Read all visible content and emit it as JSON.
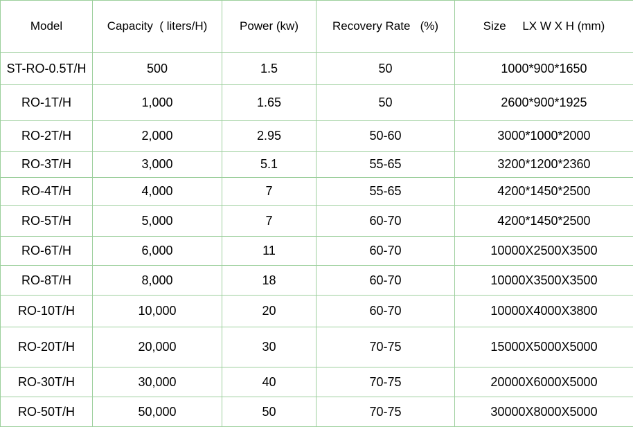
{
  "table": {
    "headers": [
      "Model",
      "Capacity  ( liters/H)",
      "Power (kw)",
      "Recovery Rate   (%)",
      "Size     LX W X H (mm)"
    ],
    "rows": [
      [
        "ST-RO-0.5T/H",
        "500",
        "1.5",
        "50",
        "1000*900*1650"
      ],
      [
        "RO-1T/H",
        "1,000",
        "1.65",
        "50",
        "2600*900*1925"
      ],
      [
        "RO-2T/H",
        "2,000",
        "2.95",
        "50-60",
        "3000*1000*2000"
      ],
      [
        "RO-3T/H",
        "3,000",
        "5.1",
        "55-65",
        "3200*1200*2360"
      ],
      [
        "RO-4T/H",
        "4,000",
        "7",
        "55-65",
        "4200*1450*2500"
      ],
      [
        "RO-5T/H",
        "5,000",
        "7",
        "60-70",
        "4200*1450*2500"
      ],
      [
        "RO-6T/H",
        "6,000",
        "11",
        "60-70",
        "10000X2500X3500"
      ],
      [
        "RO-8T/H",
        "8,000",
        "18",
        "60-70",
        "10000X3500X3500"
      ],
      [
        "RO-10T/H",
        "10,000",
        "20",
        "60-70",
        "10000X4000X3800"
      ],
      [
        "RO-20T/H",
        "20,000",
        "30",
        "70-75",
        "15000X5000X5000"
      ],
      [
        "RO-30T/H",
        "30,000",
        "40",
        "70-75",
        "20000X6000X5000"
      ],
      [
        "RO-50T/H",
        "50,000",
        "50",
        "70-75",
        "30000X8000X5000"
      ]
    ]
  },
  "colors": {
    "grid_line": "#9ccf9c",
    "background": "#ffffff",
    "text": "#000000"
  }
}
